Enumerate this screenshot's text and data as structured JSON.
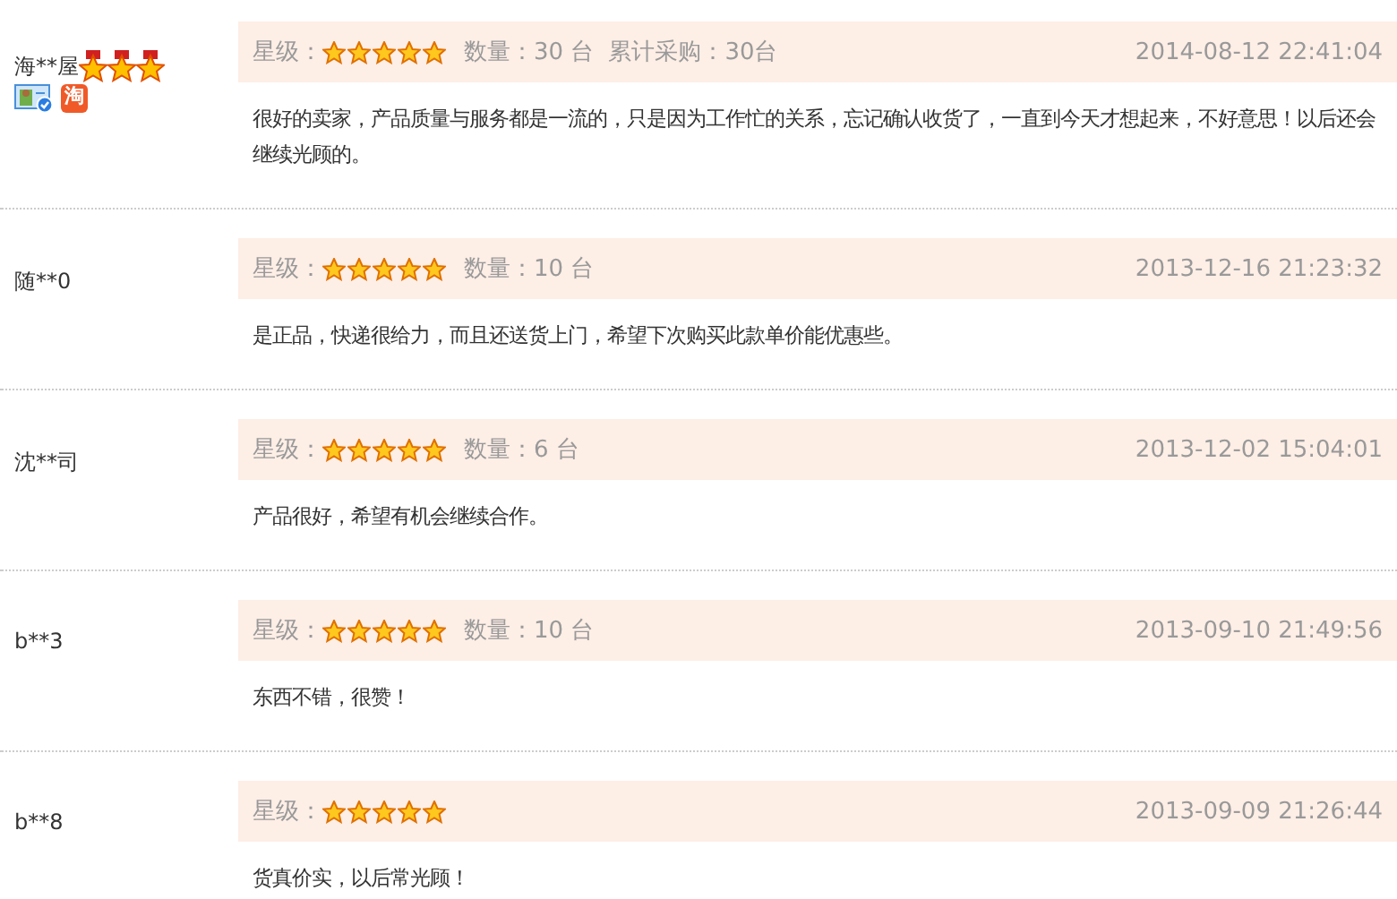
{
  "reviews": [
    {
      "user": "海**屋",
      "medals": [
        {
          "kind": "medal"
        },
        {
          "kind": "medal"
        },
        {
          "kind": "medal"
        }
      ],
      "user_icons": [
        {
          "kind": "verified-id"
        },
        {
          "kind": "shop",
          "text": "淘"
        }
      ],
      "rating_label": "星级：",
      "stars": 5,
      "quantity": "数量：30 台",
      "total": "累计采购：30台",
      "date": "2014-08-12 22:41:04",
      "comment": "很好的卖家，产品质量与服务都是一流的，只是因为工作忙的关系，忘记确认收货了，一直到今天才想起来，不好意思！以后还会继续光顾的。"
    },
    {
      "user": "随**0",
      "rating_label": "星级：",
      "stars": 5,
      "quantity": "数量：10 台",
      "date": "2013-12-16 21:23:32",
      "comment": "是正品，快递很给力，而且还送货上门，希望下次购买此款单价能优惠些。"
    },
    {
      "user": "沈**司",
      "rating_label": "星级：",
      "stars": 5,
      "quantity": "数量：6 台",
      "date": "2013-12-02 15:04:01",
      "comment": "产品很好，希望有机会继续合作。"
    },
    {
      "user": "b**3",
      "rating_label": "星级：",
      "stars": 5,
      "quantity": "数量：10 台",
      "date": "2013-09-10 21:49:56",
      "comment": "东西不错，很赞！"
    },
    {
      "user": "b**8",
      "rating_label": "星级：",
      "stars": 5,
      "date": "2013-09-09 21:26:44",
      "comment": "货真价实，以后常光顾！"
    }
  ]
}
